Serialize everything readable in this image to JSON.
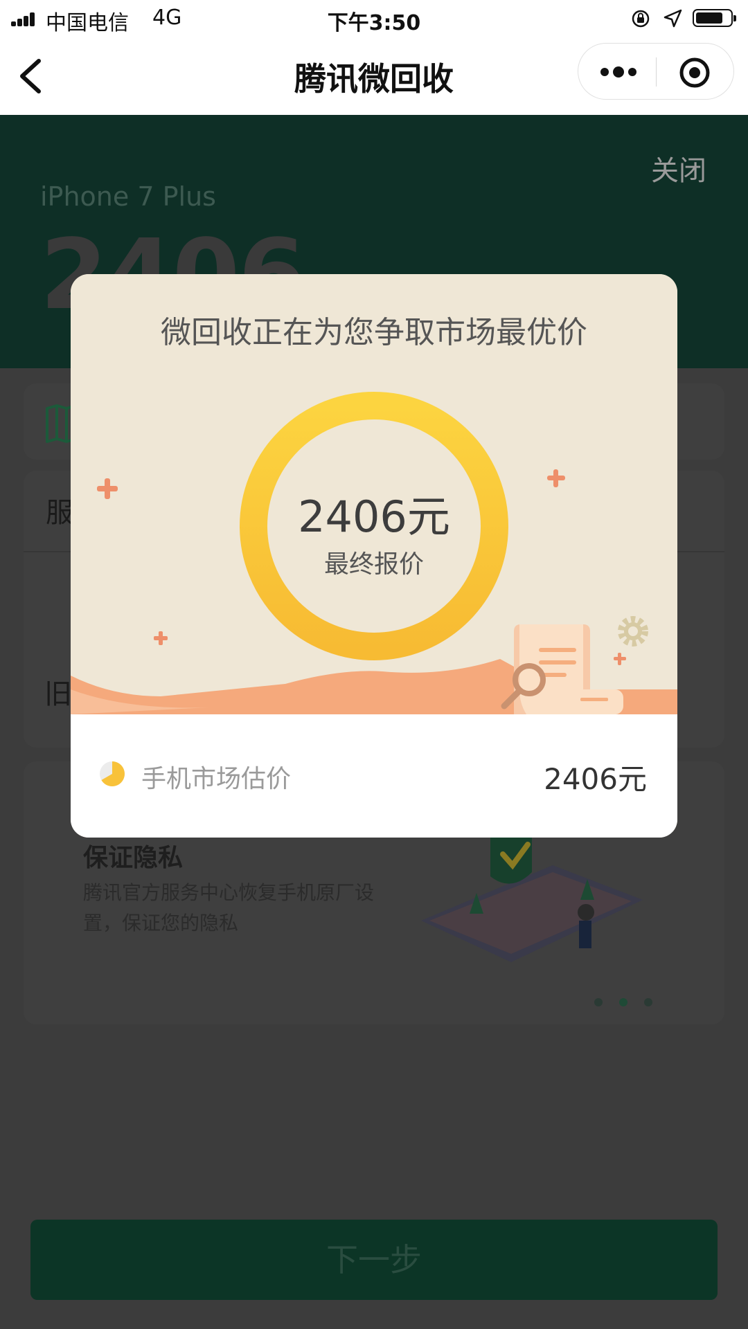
{
  "status_bar": {
    "carrier": "中国电信",
    "network": "4G",
    "time": "下午3:50"
  },
  "nav": {
    "title": "腾讯微回收"
  },
  "background_page": {
    "close_label": "关闭",
    "model": "iPhone 7 Plus",
    "price": "2406",
    "service_label_partial": "服",
    "old_label_partial": "旧",
    "privacy_title": "保证隐私",
    "privacy_desc": "腾讯官方服务中心恢复手机原厂设置，保证您的隐私",
    "next_button": "下一步",
    "carousel_pages": 3,
    "carousel_active": 2
  },
  "modal": {
    "title": "微回收正在为您争取市场最优价",
    "final_price": "2406元",
    "final_price_label": "最终报价",
    "market_label": "手机市场估价",
    "market_value": "2406元"
  },
  "colors": {
    "brand_green": "#0e2f26",
    "ring_yellow": "#f8c23a",
    "accent_orange": "#f29c6b"
  }
}
